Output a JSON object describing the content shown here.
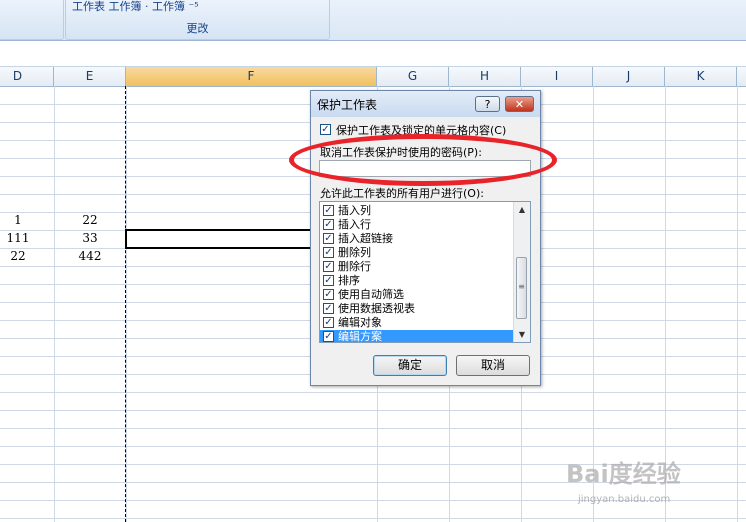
{
  "ribbon": {
    "top_text": "工作表  工作簿 · 工作簿  ⁻⁵",
    "group_label": "更改"
  },
  "column_headers": [
    "D",
    "E",
    "F",
    "G",
    "H",
    "I",
    "J",
    "K"
  ],
  "cells": [
    {
      "d": "1",
      "e": "22"
    },
    {
      "d": "111",
      "e": "33"
    },
    {
      "d": "22",
      "e": "442"
    }
  ],
  "dialog": {
    "title": "保护工作表",
    "help_label": "?",
    "close_label": "✕",
    "protect_option": "保护工作表及锁定的单元格内容(C)",
    "password_label": "取消工作表保护时使用的密码(P):",
    "password_value": "",
    "allow_label": "允许此工作表的所有用户进行(O):",
    "permissions": [
      {
        "label": "插入列",
        "checked": true,
        "selected": false
      },
      {
        "label": "插入行",
        "checked": true,
        "selected": false
      },
      {
        "label": "插入超链接",
        "checked": true,
        "selected": false
      },
      {
        "label": "删除列",
        "checked": true,
        "selected": false
      },
      {
        "label": "删除行",
        "checked": true,
        "selected": false
      },
      {
        "label": "排序",
        "checked": true,
        "selected": false
      },
      {
        "label": "使用自动筛选",
        "checked": true,
        "selected": false
      },
      {
        "label": "使用数据透视表",
        "checked": true,
        "selected": false
      },
      {
        "label": "编辑对象",
        "checked": true,
        "selected": false
      },
      {
        "label": "编辑方案",
        "checked": true,
        "selected": true
      }
    ],
    "ok_label": "确定",
    "cancel_label": "取消"
  },
  "watermark": {
    "brand": "Bai度经验",
    "url": "jingyan.baidu.com"
  },
  "colors": {
    "selected_column_header": "#f1c15f",
    "annotation_circle": "#e8242a",
    "list_selection": "#3399ff"
  }
}
